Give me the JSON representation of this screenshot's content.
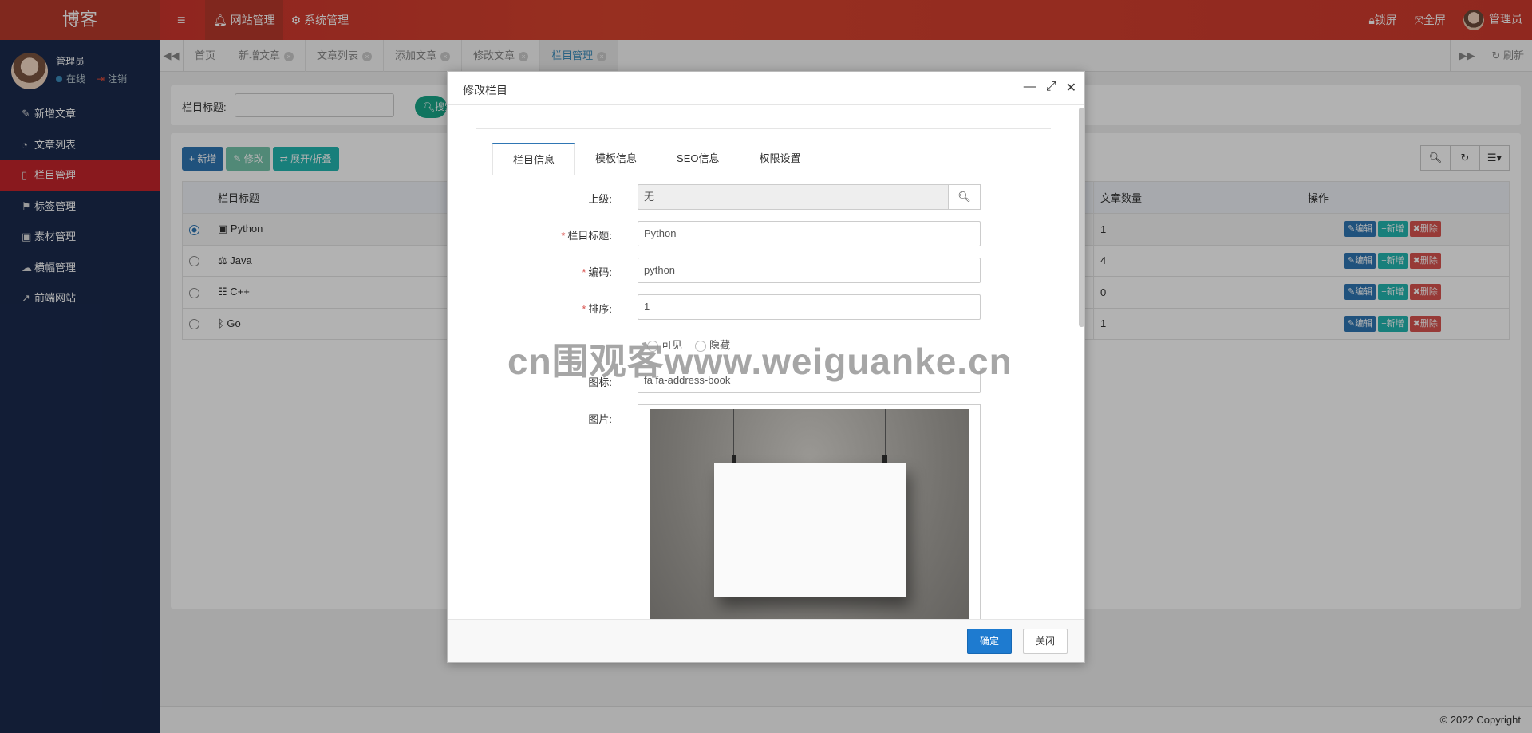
{
  "header": {
    "logo": "博客",
    "nav": [
      {
        "label": "网站管理",
        "icon": "bell-icon",
        "active": true
      },
      {
        "label": "系统管理",
        "icon": "gear-icon",
        "active": false
      }
    ],
    "lock": "锁屏",
    "fullscreen": "全屏",
    "user": "管理员"
  },
  "sidebar": {
    "user_name": "管理员",
    "online": "在线",
    "logout": "注销",
    "items": [
      {
        "label": "新增文章",
        "icon": "pencil-icon"
      },
      {
        "label": "文章列表",
        "icon": "dashboard-icon"
      },
      {
        "label": "栏目管理",
        "icon": "bookmark-icon",
        "active": true
      },
      {
        "label": "标签管理",
        "icon": "flag-icon"
      },
      {
        "label": "素材管理",
        "icon": "image-icon"
      },
      {
        "label": "横幅管理",
        "icon": "cloud-icon"
      },
      {
        "label": "前端网站",
        "icon": "external-link-icon"
      }
    ]
  },
  "tabs": [
    {
      "label": "首页",
      "closable": false
    },
    {
      "label": "新增文章",
      "closable": true
    },
    {
      "label": "文章列表",
      "closable": true
    },
    {
      "label": "添加文章",
      "closable": true
    },
    {
      "label": "修改文章",
      "closable": true
    },
    {
      "label": "栏目管理",
      "closable": true,
      "active": true
    }
  ],
  "tabs_refresh": "刷新",
  "search": {
    "label": "栏目标题:",
    "button": "搜索"
  },
  "toolbar": {
    "add": "新增",
    "edit": "修改",
    "expand": "展开/折叠"
  },
  "table": {
    "columns": [
      "",
      "栏目标题",
      "文章数量",
      "操作"
    ],
    "rows": [
      {
        "title": "Python",
        "count": "1",
        "selected": true,
        "icon": "user-box-icon"
      },
      {
        "title": "Java",
        "count": "4",
        "selected": false,
        "icon": "balance-scale-icon"
      },
      {
        "title": "C++",
        "count": "0",
        "selected": false,
        "icon": "users-icon"
      },
      {
        "title": "Go",
        "count": "1",
        "selected": false,
        "icon": "bluetooth-icon"
      }
    ],
    "ops": {
      "edit": "编辑",
      "add": "新增",
      "delete": "删除"
    }
  },
  "footer": "© 2022 Copyright",
  "modal": {
    "title": "修改栏目",
    "tabs": [
      "栏目信息",
      "模板信息",
      "SEO信息",
      "权限设置"
    ],
    "fields": {
      "parent_label": "上级:",
      "parent_value": "无",
      "title_label": "栏目标题:",
      "title_value": "Python",
      "code_label": "编码:",
      "code_value": "python",
      "sort_label": "排序:",
      "sort_value": "1",
      "visible_show": "可见",
      "visible_hide": "隐藏",
      "icon_label": "图标:",
      "icon_value": "fa fa-address-book",
      "image_label": "图片:"
    },
    "ok": "确定",
    "close": "关闭"
  },
  "watermark": "cn围观客www.weiguanke.cn"
}
